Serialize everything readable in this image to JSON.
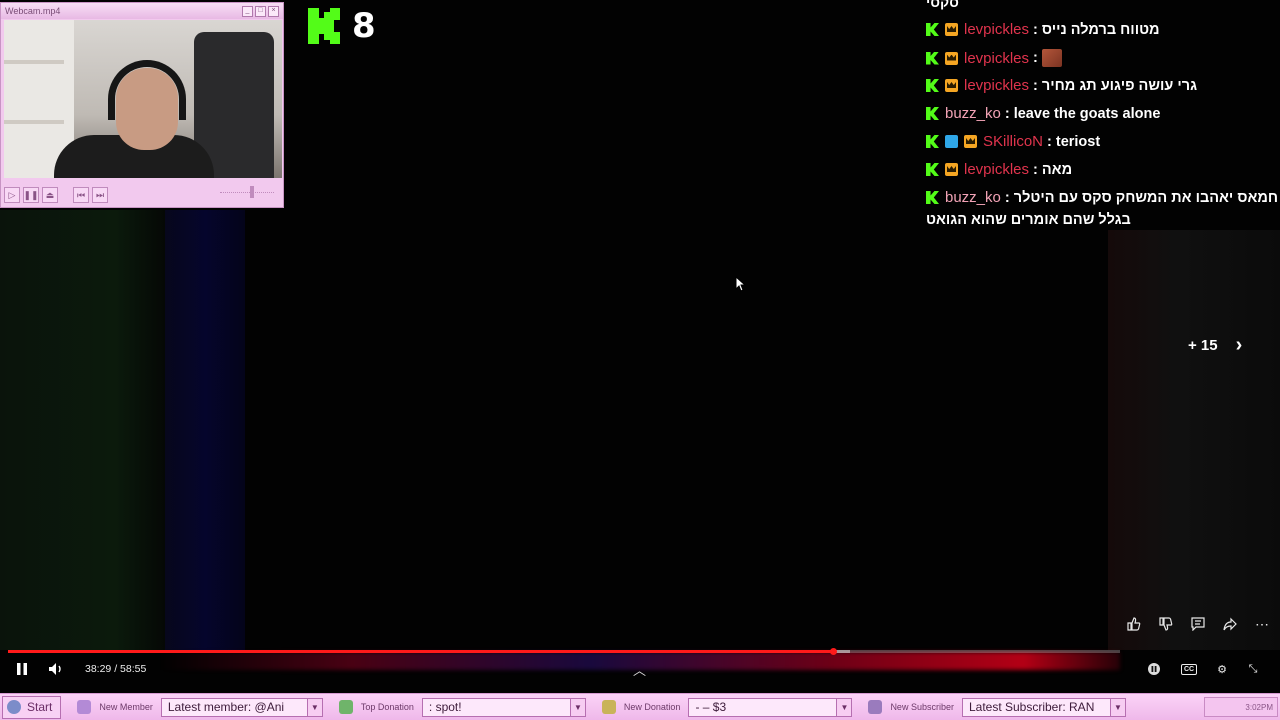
{
  "webcam": {
    "title": "Webcam.mp4"
  },
  "kick_counter": {
    "count": "8",
    "brand_color": "#53fc18"
  },
  "chat": {
    "fragment": "סקסי",
    "messages": [
      {
        "user": "levpickles",
        "text": "מטווח ברמלה נייס",
        "badges": [
          "kick-icon",
          "crown-icon"
        ]
      },
      {
        "user": "levpickles",
        "text": "",
        "emote": "face-emote",
        "badges": [
          "kick-icon",
          "crown-icon"
        ]
      },
      {
        "user": "levpickles",
        "text": "גרי עושה פיגוע תג מחיר",
        "badges": [
          "kick-icon",
          "crown-icon"
        ]
      },
      {
        "user": "buzz_ko",
        "text": "leave the goats alone",
        "badges": [
          "kick-icon"
        ]
      },
      {
        "user": "SKillicoN",
        "text": "teriost",
        "badges": [
          "kick-icon",
          "blue-badge-icon",
          "crown-icon"
        ]
      },
      {
        "user": "levpickles",
        "text": "מאה",
        "badges": [
          "kick-icon",
          "crown-icon"
        ]
      },
      {
        "user": "buzz_ko",
        "text": "חמאס יאהבו את המשחק סקס עם היטלר",
        "text2": "בגלל שהם אומרים שהוא הגואט",
        "badges": [
          "kick-icon"
        ]
      }
    ]
  },
  "skip": {
    "label": "+ 15"
  },
  "player": {
    "time": "38:29 / 58:55",
    "progress_fraction": 0.742,
    "buffer_fraction": 0.757,
    "accent_color": "#ff1a1a",
    "action_icons": [
      "like-icon",
      "dislike-icon",
      "comment-icon",
      "share-icon",
      "more-icon"
    ],
    "right_icons": [
      "miniplayer-icon",
      "captions-icon",
      "settings-icon",
      "exit-fullscreen-icon"
    ],
    "captions_label": "CC"
  },
  "taskbar": {
    "start_label": "Start",
    "groups": [
      {
        "label": "New Member",
        "value": "Latest member: @Ani"
      },
      {
        "label": "Top Donation",
        "value": ": spot!"
      },
      {
        "label": "New Donation",
        "value": "- – $3"
      },
      {
        "label": "New Subscriber",
        "value": "Latest Subscriber: RAN"
      }
    ],
    "clock": "3:02PM"
  }
}
